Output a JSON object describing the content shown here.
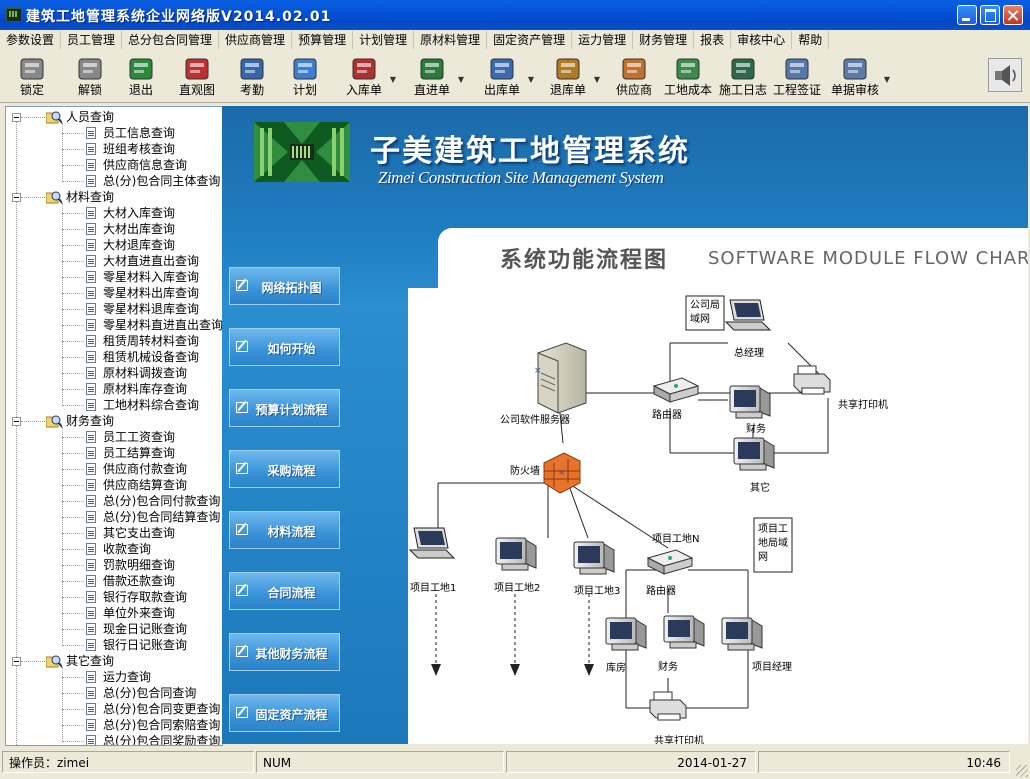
{
  "window": {
    "title": "建筑工地管理系统企业网络版V2014.02.01",
    "buttons": {
      "minimize": "minimize",
      "maximize": "maximize",
      "close": "close"
    }
  },
  "menu": [
    "参数设置",
    "员工管理",
    "总分包合同管理",
    "供应商管理",
    "预算管理",
    "计划管理",
    "原材料管理",
    "固定资产管理",
    "运力管理",
    "财务管理",
    "报表",
    "审核中心",
    "帮助"
  ],
  "toolbar": [
    {
      "label": "锁定",
      "icon": "padlock-icon"
    },
    {
      "label": "解锁",
      "icon": "unlock-icon"
    },
    {
      "label": "退出",
      "icon": "exit-door-icon"
    },
    {
      "label": "直观图",
      "icon": "bar-chart-icon"
    },
    {
      "label": "考勤",
      "icon": "attendance-icon"
    },
    {
      "label": "计划",
      "icon": "folder-plan-icon"
    },
    {
      "label": "入库单",
      "icon": "warehouse-in-icon",
      "dropdown": true
    },
    {
      "label": "直进单",
      "icon": "warehouse-direct-icon",
      "dropdown": true
    },
    {
      "label": "出库单",
      "icon": "warehouse-out-icon",
      "dropdown": true
    },
    {
      "label": "退库单",
      "icon": "warehouse-return-icon",
      "dropdown": true
    },
    {
      "label": "供应商",
      "icon": "supplier-people-icon"
    },
    {
      "label": "工地成本",
      "icon": "money-bag-icon"
    },
    {
      "label": "施工日志",
      "icon": "log-book-icon"
    },
    {
      "label": "工程签证",
      "icon": "document-icon"
    },
    {
      "label": "单据审核",
      "icon": "audit-icon",
      "dropdown": true
    }
  ],
  "tree": [
    {
      "label": "人员查询",
      "children": [
        "员工信息查询",
        "班组考核查询",
        "供应商信息查询",
        "总(分)包合同主体查询"
      ]
    },
    {
      "label": "材料查询",
      "children": [
        "大材入库查询",
        "大材出库查询",
        "大材退库查询",
        "大材直进直出查询",
        "零星材料入库查询",
        "零星材料出库查询",
        "零星材料退库查询",
        "零星材料直进直出查询",
        "租赁周转材料查询",
        "租赁机械设备查询",
        "原材料调拨查询",
        "原材料库存查询",
        "工地材料综合查询"
      ]
    },
    {
      "label": "财务查询",
      "children": [
        "员工工资查询",
        "员工结算查询",
        "供应商付款查询",
        "供应商结算查询",
        "总(分)包合同付款查询",
        "总(分)包合同结算查询",
        "其它支出查询",
        "收款查询",
        "罚款明细查询",
        "借款还款查询",
        "银行存取款查询",
        "单位外来查询",
        "现金日记账查询",
        "银行日记账查询"
      ]
    },
    {
      "label": "其它查询",
      "children": [
        "运力查询",
        "总(分)包合同查询",
        "总(分)包合同变更查询",
        "总(分)包合同索赔查询",
        "总(分)包合同奖励查询"
      ]
    }
  ],
  "banner": {
    "title_cn": "子美建筑工地管理系统",
    "title_en": "Zimei Construction Site Management System"
  },
  "nav_buttons": [
    "网络拓扑图",
    "如何开始",
    "预算计划流程",
    "采购流程",
    "材料流程",
    "合同流程",
    "其他财务流程",
    "固定资产流程"
  ],
  "flow_chart": {
    "title_cn": "系统功能流程图",
    "title_en": "SOFTWARE MODULE FLOW CHART",
    "labels": {
      "company_lan": "公司局\n域网",
      "general_manager": "总经理",
      "shared_printer": "共享打印机",
      "server": "公司软件服务器",
      "router": "路由器",
      "finance": "财务",
      "other": "其它",
      "firewall": "防火墙",
      "site_n": "项目工地N",
      "site_lan": "项目工\n地局域\n网",
      "site1": "项目工地1",
      "site2": "项目工地2",
      "site3": "项目工地3",
      "site_router": "路由器",
      "warehouse": "库房",
      "site_finance": "财务",
      "project_manager": "项目经理",
      "site_printer": "共享打印机"
    }
  },
  "status": {
    "operator": "操作员：zimei",
    "numlock": "NUM",
    "date": "2014-01-27",
    "time": "10:46"
  }
}
